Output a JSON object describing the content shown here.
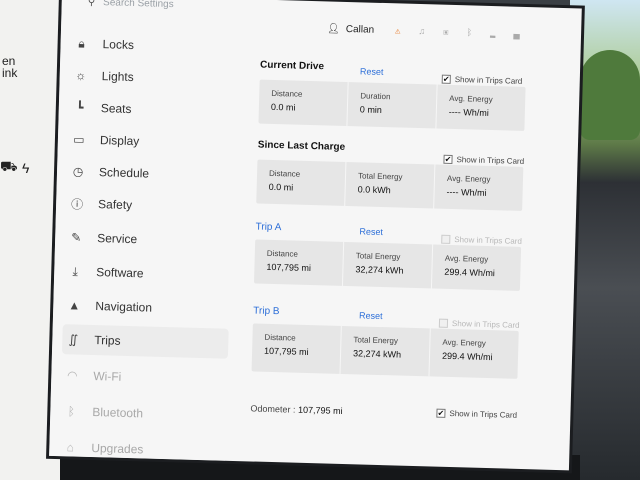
{
  "left_fragments": [
    "en",
    "ink"
  ],
  "search": {
    "placeholder": "Search Settings"
  },
  "user": {
    "name": "Callan"
  },
  "sidebar": {
    "items": [
      {
        "label": "Locks",
        "icon": "lock-icon"
      },
      {
        "label": "Lights",
        "icon": "sun-icon"
      },
      {
        "label": "Seats",
        "icon": "seat-icon"
      },
      {
        "label": "Display",
        "icon": "display-icon"
      },
      {
        "label": "Schedule",
        "icon": "clock-icon"
      },
      {
        "label": "Safety",
        "icon": "info-icon"
      },
      {
        "label": "Service",
        "icon": "wrench-icon"
      },
      {
        "label": "Software",
        "icon": "download-icon"
      },
      {
        "label": "Navigation",
        "icon": "navigation-arrow-icon"
      },
      {
        "label": "Trips",
        "icon": "trips-icon"
      },
      {
        "label": "Wi-Fi",
        "icon": "wifi-icon"
      },
      {
        "label": "Bluetooth",
        "icon": "bluetooth-icon"
      },
      {
        "label": "Upgrades",
        "icon": "shopping-bag-icon"
      }
    ],
    "active": "Trips"
  },
  "current_drive": {
    "title": "Current Drive",
    "reset": "Reset",
    "show": "Show in Trips Card",
    "show_checked": true,
    "cells": [
      {
        "label": "Distance",
        "value": "0.0 mi"
      },
      {
        "label": "Duration",
        "value": "0 min"
      },
      {
        "label": "Avg. Energy",
        "value": "---- Wh/mi"
      }
    ]
  },
  "since_last_charge": {
    "title": "Since Last Charge",
    "show": "Show in Trips Card",
    "show_checked": true,
    "cells": [
      {
        "label": "Distance",
        "value": "0.0 mi"
      },
      {
        "label": "Total Energy",
        "value": "0.0 kWh"
      },
      {
        "label": "Avg. Energy",
        "value": "---- Wh/mi"
      }
    ]
  },
  "trip_a": {
    "title": "Trip A",
    "reset": "Reset",
    "show": "Show in Trips Card",
    "show_checked": false,
    "cells": [
      {
        "label": "Distance",
        "value": "107,795 mi"
      },
      {
        "label": "Total Energy",
        "value": "32,274 kWh"
      },
      {
        "label": "Avg. Energy",
        "value": "299.4 Wh/mi"
      }
    ]
  },
  "trip_b": {
    "title": "Trip B",
    "reset": "Reset",
    "show": "Show in Trips Card",
    "show_checked": false,
    "cells": [
      {
        "label": "Distance",
        "value": "107,795 mi"
      },
      {
        "label": "Total Energy",
        "value": "32,274 kWh"
      },
      {
        "label": "Avg. Energy",
        "value": "299.4 Wh/mi"
      }
    ]
  },
  "odometer": {
    "label": "Odometer :",
    "value": "107,795 mi",
    "show": "Show in Trips Card",
    "show_checked": true
  },
  "colors": {
    "accent": "#2d6fd8",
    "card": "#e6e6e6",
    "background": "#f6f6f6"
  }
}
